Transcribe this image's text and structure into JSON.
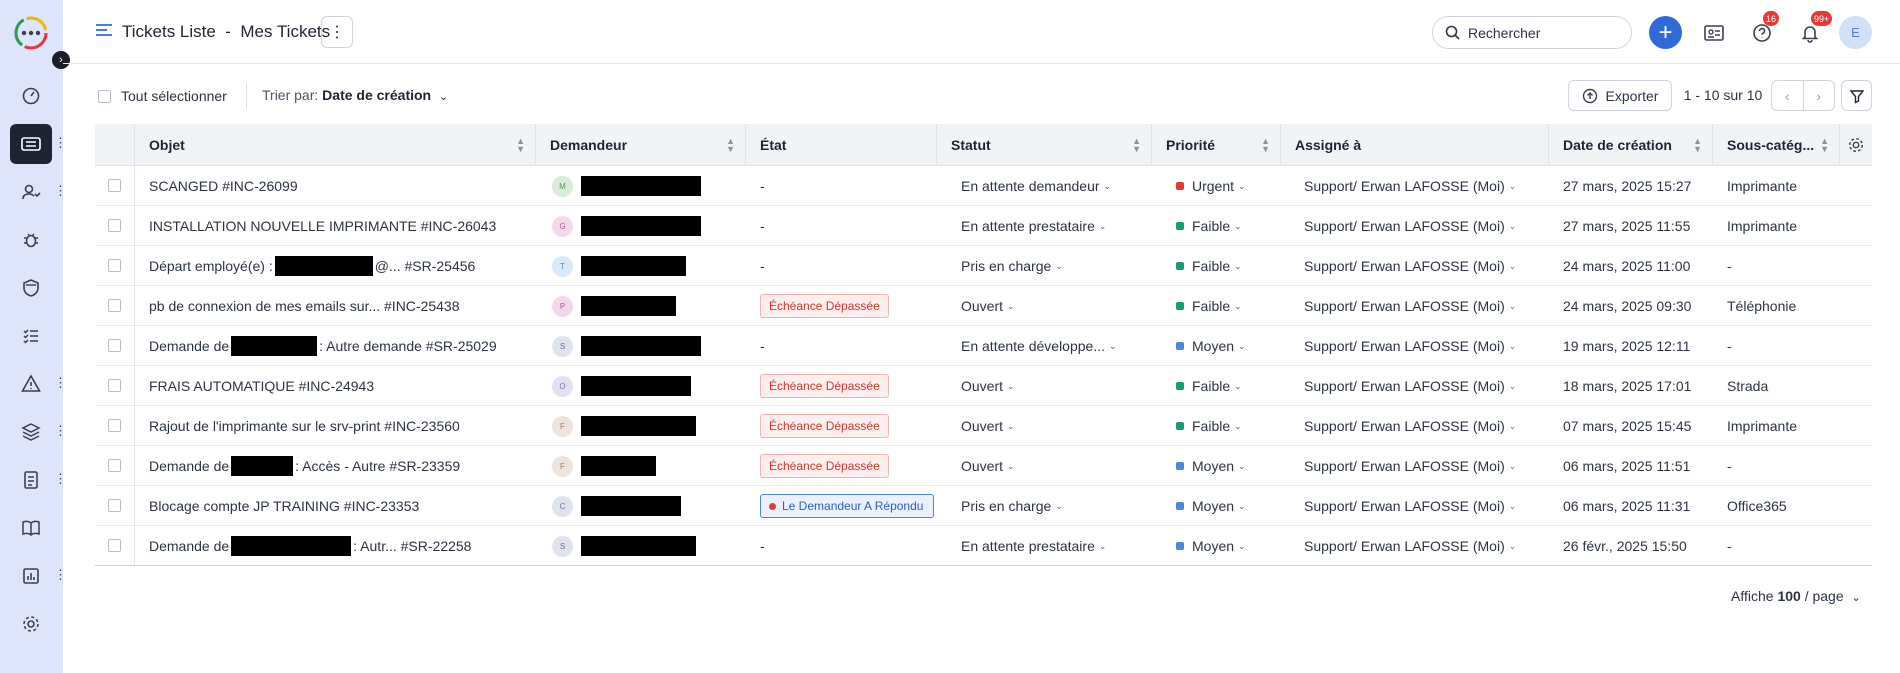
{
  "header": {
    "title": "Tickets Liste  -  Mes Tickets",
    "search_placeholder": "Rechercher",
    "help_badge": "16",
    "notif_badge": "99+",
    "avatar_initial": "E"
  },
  "toolbar": {
    "select_all": "Tout sélectionner",
    "sort_prefix": "Trier par:",
    "sort_value": "Date de création",
    "export": "Exporter",
    "pager": "1 - 10 sur 10"
  },
  "columns": [
    "Objet",
    "Demandeur",
    "État",
    "Statut",
    "Priorité",
    "Assigné à",
    "Date de création",
    "Sous-catég..."
  ],
  "rows": [
    {
      "objet": "SCANGED  #INC-26099",
      "initial": "M",
      "av_color": "#d8ecd8",
      "av_text": "#5a9a5a",
      "etat": "-",
      "statut": "En attente demandeur",
      "prio": "Urgent",
      "prio_color": "#e53935",
      "assigne": "Support/ Erwan LAFOSSE (Moi)",
      "date": "27 mars, 2025 15:27",
      "sous": "Imprimante"
    },
    {
      "objet": "INSTALLATION NOUVELLE IMPRIMANTE  #INC-26043",
      "initial": "G",
      "av_color": "#f4d8ea",
      "av_text": "#b05a92",
      "etat": "-",
      "statut": "En attente prestataire",
      "prio": "Faible",
      "prio_color": "#1a9c6a",
      "assigne": "Support/ Erwan LAFOSSE (Moi)",
      "date": "27 mars, 2025 11:55",
      "sous": "Imprimante"
    },
    {
      "objet": "Départ employé(e) :",
      "objet_tail": "@...  #SR-25456",
      "initial": "T",
      "av_color": "#d8e8f7",
      "av_text": "#5a86b5",
      "etat": "-",
      "statut": "Pris en charge",
      "prio": "Faible",
      "prio_color": "#1a9c6a",
      "assigne": "Support/ Erwan LAFOSSE (Moi)",
      "date": "24 mars, 2025 11:00",
      "sous": "-"
    },
    {
      "objet": "pb de connexion de mes emails sur...  #INC-25438",
      "initial": "P",
      "av_color": "#f2d6ec",
      "av_text": "#a85a95",
      "etat": "Échéance Dépassée",
      "statut": "Ouvert",
      "prio": "Faible",
      "prio_color": "#1a9c6a",
      "assigne": "Support/ Erwan LAFOSSE (Moi)",
      "date": "24 mars, 2025 09:30",
      "sous": "Téléphonie"
    },
    {
      "objet": "Demande de",
      "objet_tail": " : Autre demande  #SR-25029",
      "initial": "S",
      "av_color": "#dfe2ef",
      "av_text": "#6b7090",
      "etat": "-",
      "statut": "En attente développe...",
      "prio": "Moyen",
      "prio_color": "#4a86d9",
      "assigne": "Support/ Erwan LAFOSSE (Moi)",
      "date": "19 mars, 2025 12:11",
      "sous": "-"
    },
    {
      "objet": "FRAIS AUTOMATIQUE  #INC-24943",
      "initial": "O",
      "av_color": "#e2dff2",
      "av_text": "#7a70a8",
      "etat": "Échéance Dépassée",
      "statut": "Ouvert",
      "prio": "Faible",
      "prio_color": "#1a9c6a",
      "assigne": "Support/ Erwan LAFOSSE (Moi)",
      "date": "18 mars, 2025 17:01",
      "sous": "Strada"
    },
    {
      "objet": "Rajout de l'imprimante sur le srv-print  #INC-23560",
      "initial": "F",
      "av_color": "#efe2dc",
      "av_text": "#9a7a6a",
      "etat": "Échéance Dépassée",
      "statut": "Ouvert",
      "prio": "Faible",
      "prio_color": "#1a9c6a",
      "assigne": "Support/ Erwan LAFOSSE (Moi)",
      "date": "07 mars, 2025 15:45",
      "sous": "Imprimante"
    },
    {
      "objet": "Demande de",
      "objet_tail": " : Accès - Autre  #SR-23359",
      "initial": "F",
      "av_color": "#efe2dc",
      "av_text": "#9a7a6a",
      "etat": "Échéance Dépassée",
      "statut": "Ouvert",
      "prio": "Moyen",
      "prio_color": "#4a86d9",
      "assigne": "Support/ Erwan LAFOSSE (Moi)",
      "date": "06 mars, 2025 11:51",
      "sous": "-"
    },
    {
      "objet": "Blocage compte JP TRAINING  #INC-23353",
      "initial": "C",
      "av_color": "#dfe2ef",
      "av_text": "#6b7090",
      "etat": "Le Demandeur A Répondu",
      "statut": "Pris en charge",
      "prio": "Moyen",
      "prio_color": "#4a86d9",
      "assigne": "Support/ Erwan LAFOSSE (Moi)",
      "date": "06 mars, 2025 11:31",
      "sous": "Office365"
    },
    {
      "objet": "Demande de",
      "objet_tail": ": Autr...  #SR-22258",
      "initial": "S",
      "av_color": "#dfe2ef",
      "av_text": "#6b7090",
      "etat": "-",
      "statut": "En attente prestataire",
      "prio": "Moyen",
      "prio_color": "#4a86d9",
      "assigne": "Support/ Erwan LAFOSSE (Moi)",
      "date": "26 févr., 2025 15:50",
      "sous": "-"
    }
  ],
  "footer": {
    "per_page_prefix": "Affiche",
    "per_page_value": "100",
    "per_page_suffix": "/ page"
  },
  "colors": {
    "accent": "#2f6ad9",
    "sidebar_bg": "#dde4fb",
    "overdue": "#d9342b"
  }
}
